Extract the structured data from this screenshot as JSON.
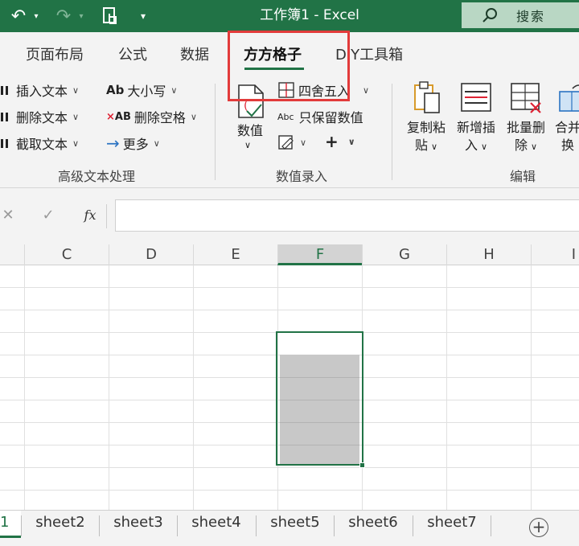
{
  "window": {
    "title": "工作簿1  -  Excel"
  },
  "search": {
    "label": "搜索"
  },
  "quick_access": {
    "undo": "↶",
    "redo": "↷",
    "more": "▾"
  },
  "tabs": [
    {
      "label": "页面布局"
    },
    {
      "label": "公式"
    },
    {
      "label": "数据"
    },
    {
      "label": "方方格子",
      "active": true
    },
    {
      "label": "DIY工具箱"
    }
  ],
  "ribbon": {
    "text_group": {
      "label": "高级文本处理",
      "items": [
        "插入文本",
        "删除文本",
        "截取文本",
        "大小写",
        "删除空格",
        "更多"
      ]
    },
    "value_group": {
      "label": "数值录入",
      "big_button": "数值",
      "items": [
        "四舍五入",
        "只保留数值"
      ],
      "plus": "+"
    },
    "edit_group": {
      "label": "编辑",
      "buttons": [
        {
          "line1": "复制粘",
          "line2": "贴"
        },
        {
          "line1": "新增插",
          "line2": "入"
        },
        {
          "line1": "批量删",
          "line2": "除"
        },
        {
          "line1": "合并",
          "line2": "换"
        }
      ]
    }
  },
  "formula_bar": {
    "cancel": "✕",
    "enter": "✓",
    "fx": "fx",
    "value": ""
  },
  "columns": [
    "C",
    "D",
    "E",
    "F",
    "G",
    "H",
    "I"
  ],
  "selected_column": "F",
  "sheets": [
    "sheet2",
    "sheet3",
    "sheet4",
    "sheet5",
    "sheet6",
    "sheet7"
  ],
  "active_sheet_stub": "1",
  "add_sheet": "+",
  "colors": {
    "accent": "#217346",
    "highlight": "#e23b3b",
    "selection_fill": "#c8c8c8"
  }
}
